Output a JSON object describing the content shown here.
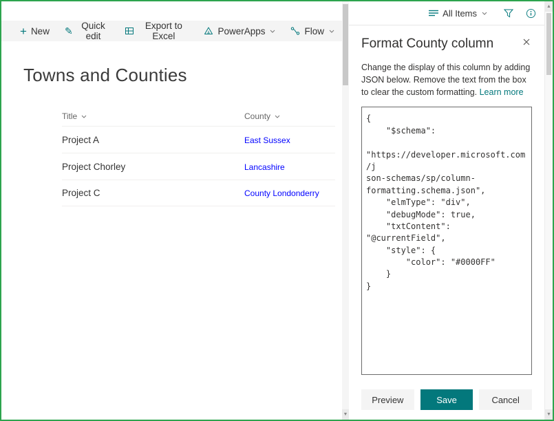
{
  "colors": {
    "accent": "#03787c",
    "border_green": "#2da44e",
    "link_blue": "#0000FF"
  },
  "command_bar": {
    "items": [
      {
        "label": "New"
      },
      {
        "label": "Quick edit"
      },
      {
        "label": "Export to Excel"
      },
      {
        "label": "PowerApps"
      },
      {
        "label": "Flow"
      }
    ]
  },
  "view_bar": {
    "view_label": "All Items"
  },
  "page": {
    "title": "Towns and Counties"
  },
  "table": {
    "columns": [
      "Title",
      "County"
    ],
    "rows": [
      {
        "title": "Project A",
        "county": "East Sussex"
      },
      {
        "title": "Project Chorley",
        "county": "Lancashire"
      },
      {
        "title": "Project C",
        "county": "County Londonderry"
      }
    ]
  },
  "panel": {
    "title": "Format County column",
    "description": "Change the display of this column by adding JSON below. Remove the text from the box to clear the custom formatting. ",
    "learn_more": "Learn more",
    "json_value": "{\n    \"$schema\":\n\n\"https://developer.microsoft.com/j\nson-schemas/sp/column-\nformatting.schema.json\",\n    \"elmType\": \"div\",\n    \"debugMode\": true,\n    \"txtContent\": \"@currentField\",\n    \"style\": {\n        \"color\": \"#0000FF\"\n    }\n}",
    "buttons": {
      "preview": "Preview",
      "save": "Save",
      "cancel": "Cancel"
    }
  }
}
